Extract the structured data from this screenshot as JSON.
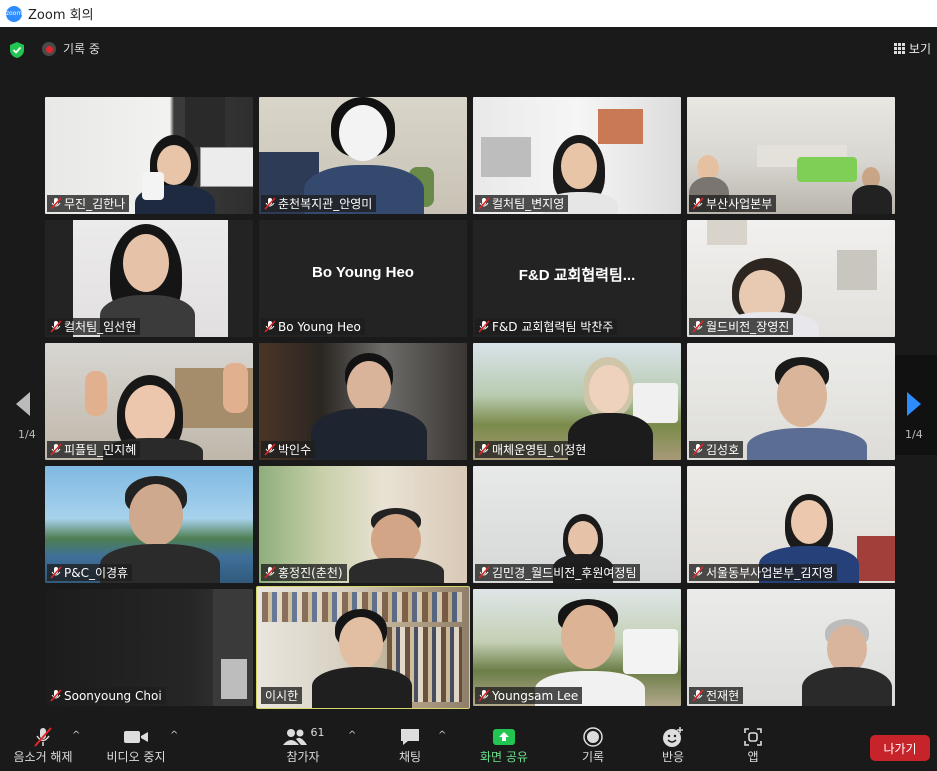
{
  "window": {
    "title": "Zoom 회의",
    "logo_text": "zoom"
  },
  "topbar": {
    "recording_text": "기록 중",
    "view_label": "보기"
  },
  "pagination": {
    "left": "1/4",
    "right": "1/4"
  },
  "participants": [
    {
      "name": "무진_김한나"
    },
    {
      "name": "춘천복지관_안영미"
    },
    {
      "name": "컬처팀_변지영"
    },
    {
      "name": "부산사업본부"
    },
    {
      "name": "컬처팀_임선현"
    },
    {
      "name": "Bo Young Heo",
      "display": "Bo Young Heo"
    },
    {
      "name": "F&D 교회협력팀 박찬주",
      "display": "F&D 교회협력팀..."
    },
    {
      "name": "월드비전_장영진"
    },
    {
      "name": "피플팀_민지혜"
    },
    {
      "name": "박인수"
    },
    {
      "name": "매체운영팀_이정현"
    },
    {
      "name": "김성호"
    },
    {
      "name": "P&C_이경휴"
    },
    {
      "name": "홍정진(춘천)"
    },
    {
      "name": "김민경_월드비전_후원여정팀"
    },
    {
      "name": "서울동부사업본부_김지영"
    },
    {
      "name": "Soonyoung Choi"
    },
    {
      "name": "이시한"
    },
    {
      "name": "Youngsam Lee"
    },
    {
      "name": "전재현"
    }
  ],
  "toolbar": {
    "unmute": "음소거 해제",
    "stop_video": "비디오 중지",
    "participants": "참가자",
    "participant_count": "61",
    "chat": "채팅",
    "share_screen": "화면 공유",
    "record": "기록",
    "reactions": "반응",
    "apps": "앱",
    "leave": "나가기"
  },
  "colors": {
    "share_green": "#23c552",
    "leave_red": "#c6232a",
    "active_border": "#d7d767",
    "nav_arrow": "#2d8cff"
  }
}
